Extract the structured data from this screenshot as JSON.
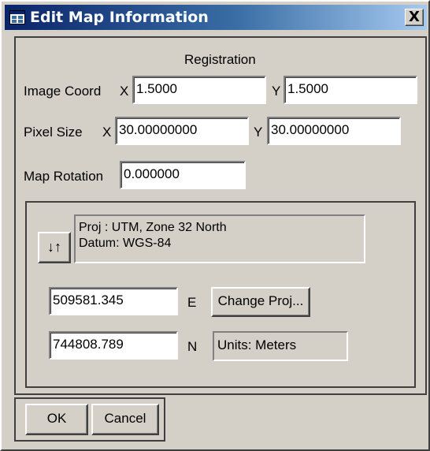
{
  "window": {
    "title": "Edit Map Information",
    "title_icon": "map-window-icon",
    "close_label": "X"
  },
  "registration": {
    "heading": "Registration",
    "image_coord": {
      "label": "Image Coord",
      "x_label": "X",
      "x_value": "1.5000",
      "y_label": "Y",
      "y_value": "1.5000"
    },
    "pixel_size": {
      "label": "Pixel Size",
      "x_label": "X",
      "x_value": "30.00000000",
      "y_label": "Y",
      "y_value": "30.00000000"
    },
    "map_rotation": {
      "label": "Map Rotation",
      "value": "0.000000"
    }
  },
  "projection": {
    "toggle_icon": "swap-arrows-icon",
    "toggle_glyph": "↓↑",
    "proj_line": "Proj : UTM, Zone 32 North",
    "datum_line": "Datum: WGS-84",
    "easting": {
      "value": "509581.345",
      "label": "E"
    },
    "northing": {
      "value": "744808.789",
      "label": "N"
    },
    "change_proj_label": "Change Proj...",
    "units_text": "Units: Meters"
  },
  "buttons": {
    "ok_label": "OK",
    "cancel_label": "Cancel"
  }
}
